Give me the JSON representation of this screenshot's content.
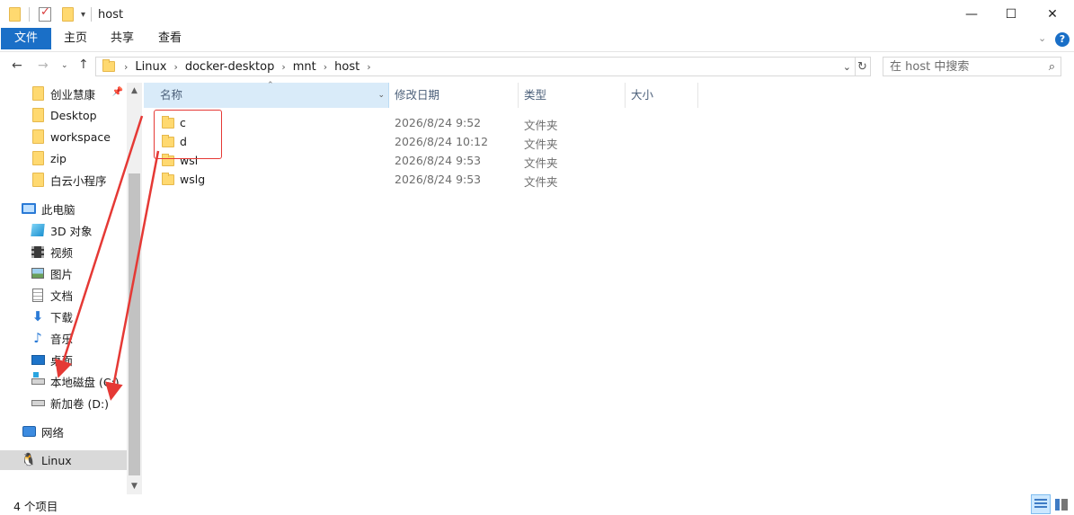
{
  "window": {
    "title": "host",
    "controls": {
      "minimize": "—",
      "maximize": "☐",
      "close": "✕"
    }
  },
  "ribbon": {
    "tabs": [
      {
        "label": "文件",
        "active": true
      },
      {
        "label": "主页"
      },
      {
        "label": "共享"
      },
      {
        "label": "查看"
      }
    ],
    "expand_icon": "chevron-down-icon",
    "help_icon": "help-icon"
  },
  "address": {
    "breadcrumbs": [
      "Linux",
      "docker-desktop",
      "mnt",
      "host"
    ],
    "search_placeholder": "在 host 中搜索"
  },
  "nav_pane": {
    "quick_access": [
      {
        "label": "创业慧康",
        "icon": "folder-icon",
        "pinned": true
      },
      {
        "label": "Desktop",
        "icon": "folder-icon"
      },
      {
        "label": "workspace",
        "icon": "folder-icon"
      },
      {
        "label": "zip",
        "icon": "folder-icon"
      },
      {
        "label": "白云小程序",
        "icon": "folder-icon"
      }
    ],
    "this_pc": {
      "label": "此电脑",
      "icon": "computer-icon"
    },
    "pc_items": [
      {
        "label": "3D 对象",
        "icon": "3d-objects-icon"
      },
      {
        "label": "视频",
        "icon": "video-icon"
      },
      {
        "label": "图片",
        "icon": "pictures-icon"
      },
      {
        "label": "文档",
        "icon": "documents-icon"
      },
      {
        "label": "下载",
        "icon": "download-icon"
      },
      {
        "label": "音乐",
        "icon": "music-icon"
      },
      {
        "label": "桌面",
        "icon": "desktop-icon"
      },
      {
        "label": "本地磁盘 (C:)",
        "icon": "drive-c-icon"
      },
      {
        "label": "新加卷 (D:)",
        "icon": "drive-d-icon"
      }
    ],
    "network": {
      "label": "网络",
      "icon": "network-icon"
    },
    "linux": {
      "label": "Linux",
      "icon": "linux-icon",
      "selected": true
    }
  },
  "columns": {
    "name": "名称",
    "modified": "修改日期",
    "type": "类型",
    "size": "大小"
  },
  "files": [
    {
      "name": "c",
      "modified": "2026/8/24 9:52",
      "type": "文件夹",
      "size": ""
    },
    {
      "name": "d",
      "modified": "2026/8/24 10:12",
      "type": "文件夹",
      "size": ""
    },
    {
      "name": "wsl",
      "modified": "2026/8/24 9:53",
      "type": "文件夹",
      "size": ""
    },
    {
      "name": "wslg",
      "modified": "2026/8/24 9:53",
      "type": "文件夹",
      "size": ""
    }
  ],
  "annotation": {
    "highlighted_items": [
      "c",
      "d"
    ],
    "arrow_targets": [
      "本地磁盘 (C:)",
      "新加卷 (D:)"
    ],
    "color": "#e53935"
  },
  "status": {
    "item_count": "4 个项目",
    "view_mode": "details"
  },
  "colors": {
    "accent": "#1a6fc7",
    "folder": "#ffd970",
    "selected_bg": "#d9d9d9",
    "sorted_col_bg": "#d9ebf9"
  }
}
